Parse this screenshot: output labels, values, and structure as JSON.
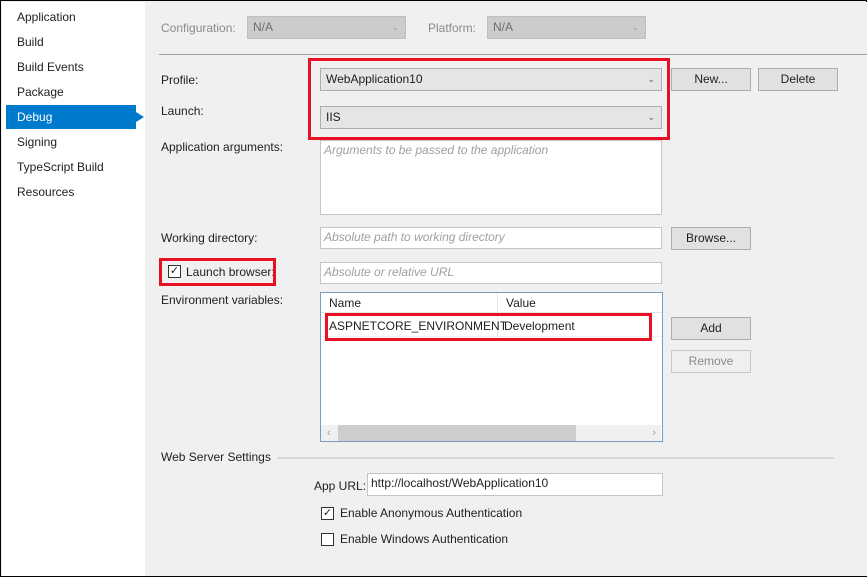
{
  "sidebar": {
    "items": [
      {
        "label": "Application",
        "active": false
      },
      {
        "label": "Build",
        "active": false
      },
      {
        "label": "Build Events",
        "active": false
      },
      {
        "label": "Package",
        "active": false
      },
      {
        "label": "Debug",
        "active": true
      },
      {
        "label": "Signing",
        "active": false
      },
      {
        "label": "TypeScript Build",
        "active": false
      },
      {
        "label": "Resources",
        "active": false
      }
    ]
  },
  "top": {
    "configuration_label": "Configuration:",
    "configuration_value": "N/A",
    "platform_label": "Platform:",
    "platform_value": "N/A"
  },
  "debug": {
    "profile_label": "Profile:",
    "profile_value": "WebApplication10",
    "new_button": "New...",
    "delete_button": "Delete",
    "launch_label": "Launch:",
    "launch_value": "IIS",
    "app_args_label": "Application arguments:",
    "app_args_placeholder": "Arguments to be passed to the application",
    "working_dir_label": "Working directory:",
    "working_dir_placeholder": "Absolute path to working directory",
    "browse_button": "Browse...",
    "launch_browser_label": "Launch browser:",
    "launch_browser_checked": true,
    "launch_browser_placeholder": "Absolute or relative URL",
    "env_vars_label": "Environment variables:",
    "env_table": {
      "columns": [
        "Name",
        "Value"
      ],
      "rows": [
        {
          "name": "ASPNETCORE_ENVIRONMENT",
          "value": "Development"
        }
      ]
    },
    "add_button": "Add",
    "remove_button": "Remove"
  },
  "web_server": {
    "section_title": "Web Server Settings",
    "app_url_label": "App URL:",
    "app_url_value": "http://localhost/WebApplication10",
    "anon_auth_label": "Enable Anonymous Authentication",
    "anon_auth_checked": true,
    "windows_auth_label": "Enable Windows Authentication",
    "windows_auth_checked": false
  },
  "icons": {
    "chevron": "⌄",
    "check": "✓",
    "left_arrow": "‹",
    "right_arrow": "›"
  },
  "colors": {
    "accent": "#007acc",
    "highlight": "#e81123"
  }
}
